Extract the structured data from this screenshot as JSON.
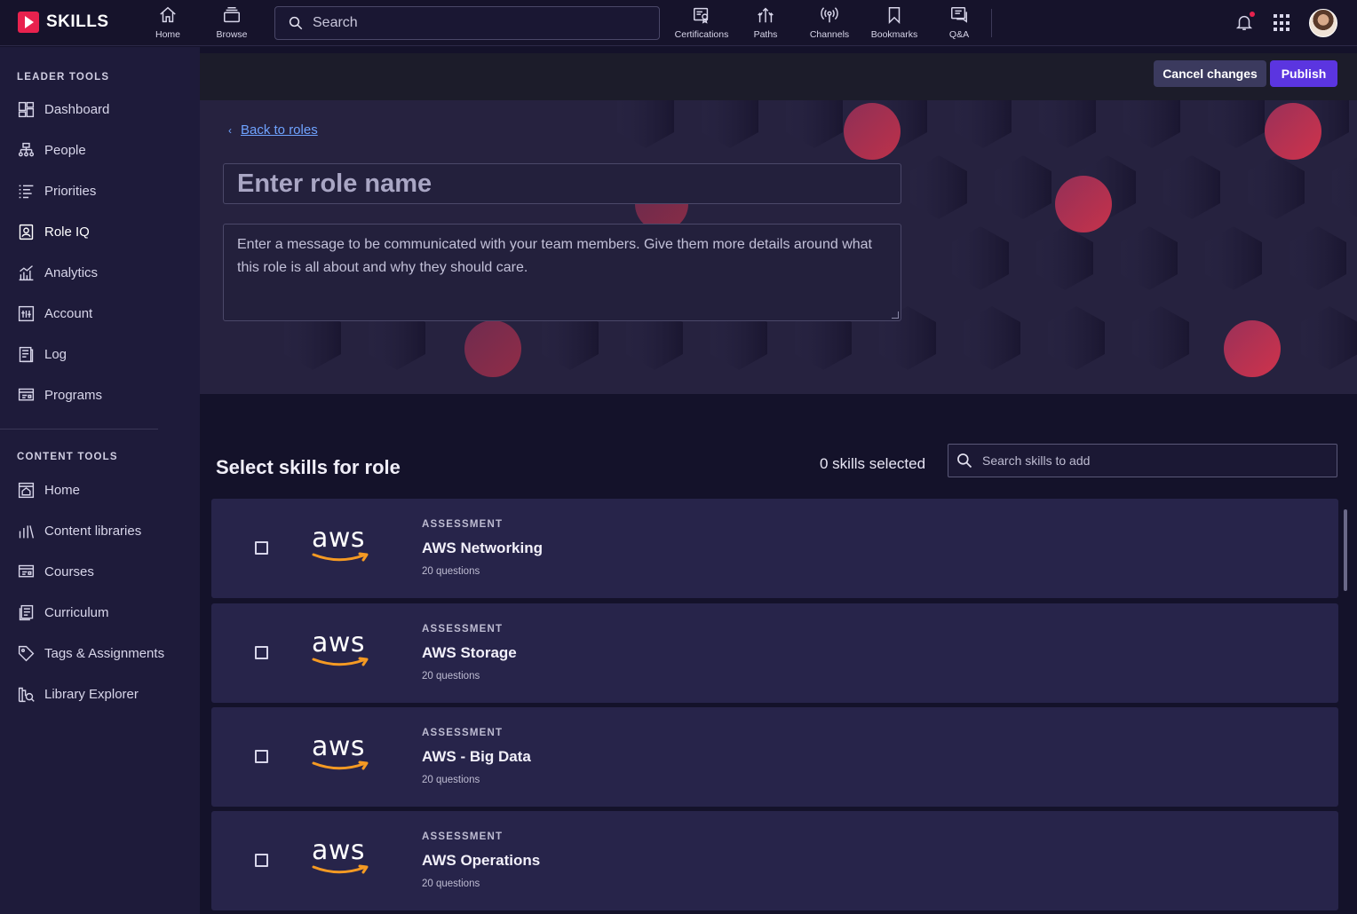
{
  "brand": {
    "name": "SKILLS",
    "accent": "#e8224e"
  },
  "topnav": {
    "items": [
      {
        "label": "Home",
        "icon": "home-icon"
      },
      {
        "label": "Browse",
        "icon": "browse-icon"
      },
      {
        "label": "Certifications",
        "icon": "certifications-icon"
      },
      {
        "label": "Paths",
        "icon": "paths-icon"
      },
      {
        "label": "Channels",
        "icon": "channels-icon"
      },
      {
        "label": "Bookmarks",
        "icon": "bookmark-icon"
      },
      {
        "label": "Q&A",
        "icon": "qa-icon"
      }
    ],
    "search_placeholder": "Search"
  },
  "sidebar": {
    "leader_heading": "LEADER TOOLS",
    "leader_items": [
      {
        "label": "Dashboard",
        "icon": "dashboard-icon"
      },
      {
        "label": "People",
        "icon": "people-icon"
      },
      {
        "label": "Priorities",
        "icon": "priorities-icon"
      },
      {
        "label": "Role IQ",
        "icon": "role-iq-icon",
        "active": true
      },
      {
        "label": "Analytics",
        "icon": "analytics-icon"
      },
      {
        "label": "Account",
        "icon": "account-icon"
      },
      {
        "label": "Log",
        "icon": "log-icon"
      },
      {
        "label": "Programs",
        "icon": "programs-icon"
      }
    ],
    "content_heading": "CONTENT TOOLS",
    "content_items": [
      {
        "label": "Home",
        "icon": "content-home-icon"
      },
      {
        "label": "Content libraries",
        "icon": "libraries-icon"
      },
      {
        "label": "Courses",
        "icon": "courses-icon"
      },
      {
        "label": "Curriculum",
        "icon": "curriculum-icon"
      },
      {
        "label": "Tags & Assignments",
        "icon": "tag-icon"
      },
      {
        "label": "Library Explorer",
        "icon": "library-explorer-icon"
      }
    ]
  },
  "actions": {
    "cancel_label": "Cancel changes",
    "publish_label": "Publish",
    "publish_color": "#5b35e0"
  },
  "editor": {
    "back_label": "Back to roles",
    "role_name_placeholder": "Enter role name",
    "message_placeholder": "Enter a message to be communicated with your team members. Give them more details around what this role is all about and why they should care."
  },
  "skills": {
    "title": "Select skills for role",
    "selected_count": "0 skills selected",
    "search_placeholder": "Search skills to add",
    "items": [
      {
        "logo": "aws",
        "kind": "ASSESSMENT",
        "name": "AWS Networking",
        "questions": "20 questions",
        "checked": false
      },
      {
        "logo": "aws",
        "kind": "ASSESSMENT",
        "name": "AWS Storage",
        "questions": "20 questions",
        "checked": false
      },
      {
        "logo": "aws",
        "kind": "ASSESSMENT",
        "name": "AWS - Big Data",
        "questions": "20 questions",
        "checked": false
      },
      {
        "logo": "aws",
        "kind": "ASSESSMENT",
        "name": "AWS Operations",
        "questions": "20 questions",
        "checked": false
      }
    ]
  }
}
